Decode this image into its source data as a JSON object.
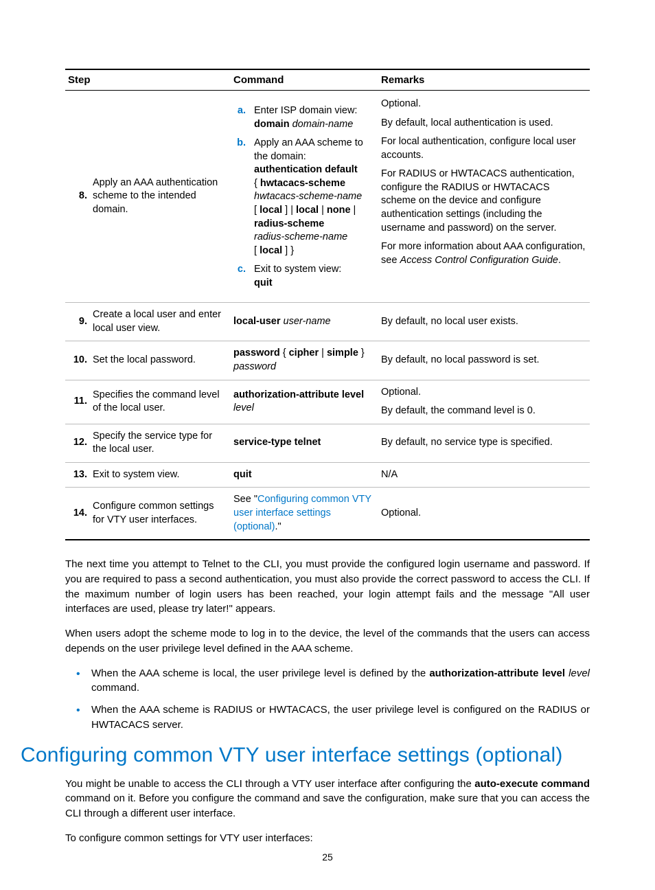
{
  "table": {
    "headers": {
      "step": "Step",
      "command": "Command",
      "remarks": "Remarks"
    },
    "row8": {
      "num": "8.",
      "desc": "Apply an AAA authentication scheme to the intended domain.",
      "sub": {
        "a_seq": "a.",
        "a_text_1": "Enter ISP domain view:",
        "a_cmd_b": "domain",
        "a_cmd_i": " domain-name",
        "b_seq": "b.",
        "b_text_1": "Apply an AAA scheme to the domain:",
        "b_line1_b": "authentication default",
        "b_line2_open": "{ ",
        "b_line2_b": "hwtacacs-scheme",
        "b_line3_i": "hwtacacs-scheme-name",
        "b_line4_open": "[ ",
        "b_line4_b1": "local",
        "b_line4_mid1": " ] | ",
        "b_line4_b2": "local",
        "b_line4_mid2": " | ",
        "b_line4_b3": "none",
        "b_line4_end": " |",
        "b_line5_b": "radius-scheme",
        "b_line6_i": "radius-scheme-name",
        "b_line7_open": "[ ",
        "b_line7_b": "local",
        "b_line7_end": " ] }",
        "c_seq": "c.",
        "c_text_1": "Exit to system view:",
        "c_cmd_b": "quit"
      },
      "remarks": {
        "p1": "Optional.",
        "p2": "By default, local authentication is used.",
        "p3": "For local authentication, configure local user accounts.",
        "p4": "For RADIUS or HWTACACS authentication, configure the RADIUS or HWTACACS scheme on the device and configure authentication settings (including the username and password) on the server.",
        "p5_a": "For more information about AAA configuration, see ",
        "p5_i": "Access Control Configuration Guide",
        "p5_b": "."
      }
    },
    "row9": {
      "num": "9.",
      "desc": "Create a local user and enter local user view.",
      "cmd_b": "local-user",
      "cmd_i": " user-name",
      "rem": "By default, no local user exists."
    },
    "row10": {
      "num": "10.",
      "desc": "Set the local password.",
      "cmd_b1": "password",
      "cmd_mid1": " { ",
      "cmd_b2": "cipher",
      "cmd_mid2": " | ",
      "cmd_b3": "simple",
      "cmd_mid3": " } ",
      "cmd_i": "password",
      "rem": "By default, no local password is set."
    },
    "row11": {
      "num": "11.",
      "desc": "Specifies the command level of the local user.",
      "cmd_b": "authorization-attribute level",
      "cmd_i": "level",
      "rem1": "Optional.",
      "rem2": "By default, the command level is 0."
    },
    "row12": {
      "num": "12.",
      "desc": "Specify the service type for the local user.",
      "cmd_b": "service-type telnet",
      "rem": "By default, no service type is specified."
    },
    "row13": {
      "num": "13.",
      "desc": "Exit to system view.",
      "cmd_b": "quit",
      "rem": "N/A"
    },
    "row14": {
      "num": "14.",
      "desc": "Configure common settings for VTY user interfaces.",
      "cmd_pre": "See \"",
      "cmd_link": "Configuring common VTY user interface settings (optional)",
      "cmd_post": ".\"",
      "rem": "Optional."
    }
  },
  "body": {
    "p1": "The next time you attempt to Telnet to the CLI, you must provide the configured login username and password. If you are required to pass a second authentication, you must also provide the correct password to access the CLI. If the maximum number of login users has been reached, your login attempt fails and the message \"All user interfaces are used, please try later!\" appears.",
    "p2": "When users adopt the scheme mode to log in to the device, the level of the commands that the users can access depends on the user privilege level defined in the AAA scheme.",
    "b1_pre": "When the AAA scheme is local, the user privilege level is defined by the ",
    "b1_bold": "authorization-attribute level",
    "b1_sp": " ",
    "b1_ital": "level",
    "b1_post": " command.",
    "b2": "When the AAA scheme is RADIUS or HWTACACS, the user privilege level is configured on the RADIUS or HWTACACS server."
  },
  "heading": "Configuring common VTY user interface settings (optional)",
  "after": {
    "p1_pre": "You might be unable to access the CLI through a VTY user interface after configuring the ",
    "p1_bold": "auto-execute command",
    "p1_post": " command on it. Before you configure the command and save the configuration, make sure that you can access the CLI through a different user interface.",
    "p2": "To configure common settings for VTY user interfaces:"
  },
  "pagenum": "25"
}
